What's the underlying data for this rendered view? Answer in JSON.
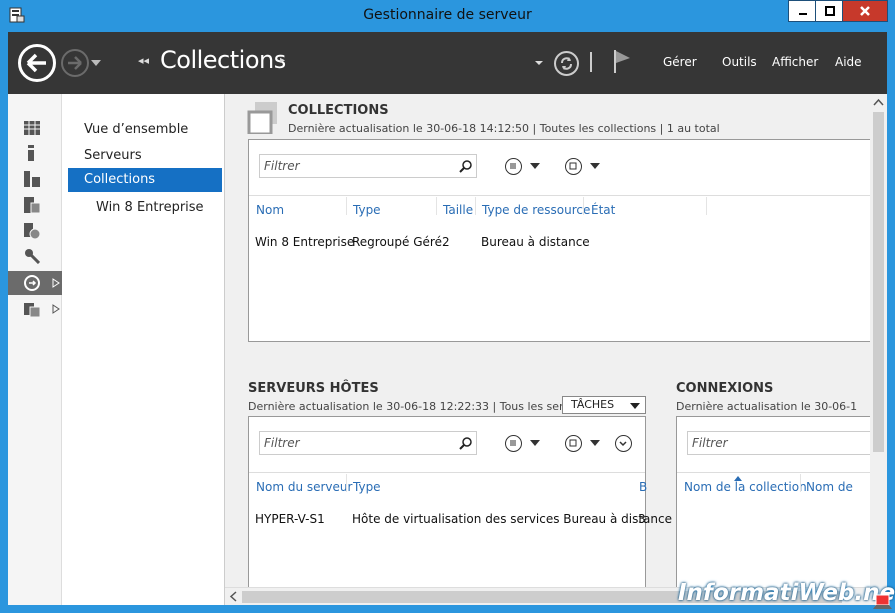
{
  "window": {
    "title": "Gestionnaire de serveur"
  },
  "toolbar": {
    "breadcrumb": "Collections",
    "menus": [
      "Gérer",
      "Outils",
      "Afficher",
      "Aide"
    ]
  },
  "nav": {
    "items": [
      "Vue d’ensemble",
      "Serveurs",
      "Collections",
      "Win 8 Entreprise"
    ],
    "selected": "Collections"
  },
  "collections": {
    "title": "COLLECTIONS",
    "subtitle": "Dernière actualisation le 30-06-18 14:12:50 | Toutes les collections | 1 au total",
    "filter_placeholder": "Filtrer",
    "columns": [
      "Nom",
      "Type",
      "Taille",
      "Type de ressource",
      "État"
    ],
    "rows": [
      [
        "Win 8 Entreprise",
        "Regroupé Géré",
        "2",
        "Bureau à distance",
        ""
      ]
    ]
  },
  "hosts": {
    "title": "SERVEURS HÔTES",
    "subtitle": "Dernière actualisation le 30-06-18 12:22:33 | Tous les ser...",
    "tasks_label": "TÂCHES",
    "filter_placeholder": "Filtrer",
    "columns": [
      "Nom du serveur",
      "Type",
      "B"
    ],
    "rows": [
      [
        "HYPER-V-S1",
        "Hôte de virtualisation des services Bureau à distance",
        "3"
      ]
    ]
  },
  "connections": {
    "title": "CONNEXIONS",
    "subtitle": "Dernière actualisation le 30-06-1",
    "filter_placeholder": "Filtrer",
    "columns": [
      "Nom de la collection",
      "Nom de"
    ]
  },
  "watermark": "InformatiWeb.net",
  "colors": {
    "frame": "#2b96de",
    "toolbar": "#363636",
    "selected": "#1570c4",
    "column_header": "#2a6db5"
  }
}
